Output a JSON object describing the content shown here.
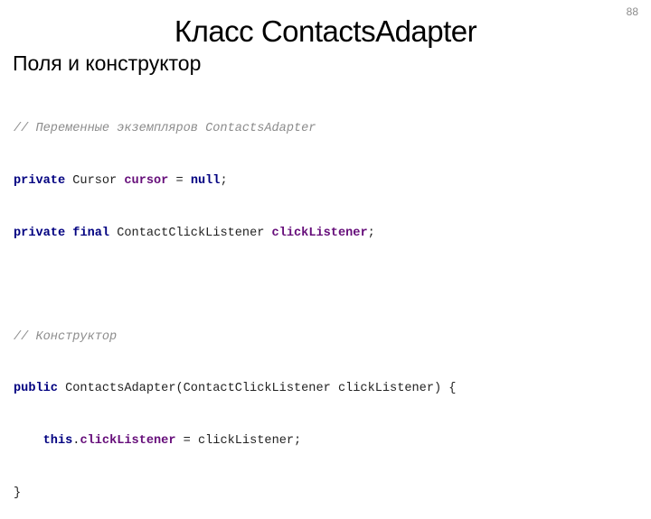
{
  "slide": {
    "number": "88",
    "title": "Класс ContactsAdapter",
    "subtitle": "Поля и конструктор"
  },
  "colors": {
    "keyword": "#000080",
    "field": "#660e7a",
    "comment": "#8c8c8c",
    "text": "#222222"
  },
  "code": {
    "line1": {
      "comment": "// Переменные экземпляров ContactsAdapter"
    },
    "line2": {
      "kw1": "private",
      "t1": " Cursor ",
      "fld": "cursor",
      "t2": " = ",
      "kw2": "null",
      "t3": ";"
    },
    "line3": {
      "kw1": "private",
      "s1": " ",
      "kw2": "final",
      "t1": " ContactClickListener ",
      "fld": "clickListener",
      "t2": ";"
    },
    "line4": {
      "text": ""
    },
    "line5": {
      "comment": "// Конструктор"
    },
    "line6": {
      "kw1": "public",
      "t1": " ContactsAdapter(ContactClickListener clickListener) {"
    },
    "line7": {
      "indent": "    ",
      "kw1": "this",
      "t1": ".",
      "fld": "clickListener",
      "t2": " = clickListener;"
    },
    "line8": {
      "text": "}"
    }
  }
}
